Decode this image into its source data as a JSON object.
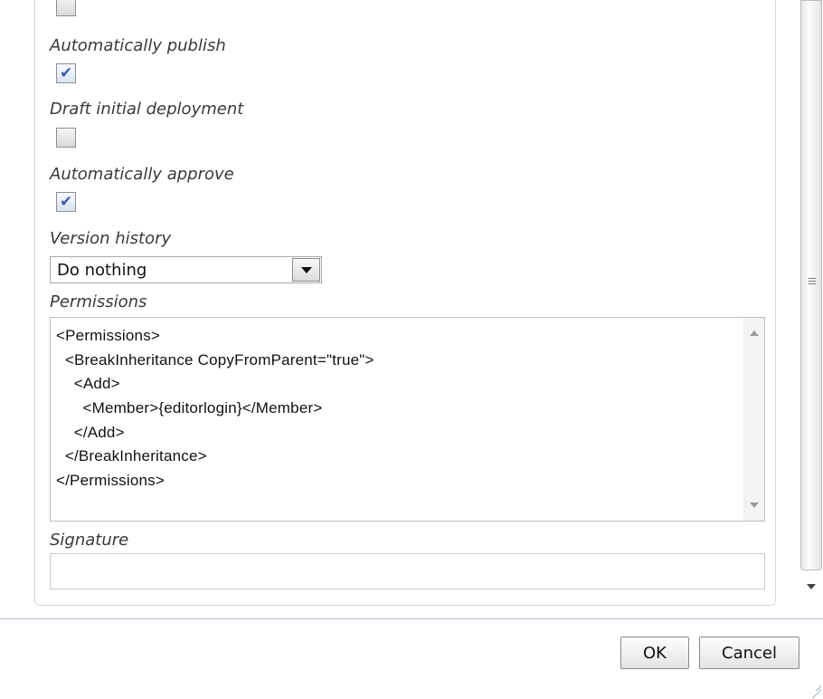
{
  "form": {
    "auto_publish_label": "Automatically publish",
    "auto_publish_checked": true,
    "draft_initial_label": "Draft initial deployment",
    "draft_initial_checked": false,
    "auto_approve_label": "Automatically approve",
    "auto_approve_checked": true,
    "version_history_label": "Version history",
    "version_history_value": "Do nothing",
    "permissions_label": "Permissions",
    "permissions_lines": [
      "<Permissions>",
      "  <BreakInheritance CopyFromParent=\"true\">",
      "    <Add>",
      "      <Member>{editorlogin}</Member>",
      "    </Add>",
      "  </BreakInheritance>",
      "</Permissions>"
    ],
    "signature_label": "Signature",
    "signature_value": ""
  },
  "footer": {
    "ok_label": "OK",
    "cancel_label": "Cancel"
  },
  "icons": {
    "checkmark": "checkmark-icon",
    "dropdown": "chevron-down-icon",
    "scroll_up": "arrow-up-icon",
    "scroll_down": "arrow-down-icon",
    "resize": "resize-grip-icon"
  }
}
